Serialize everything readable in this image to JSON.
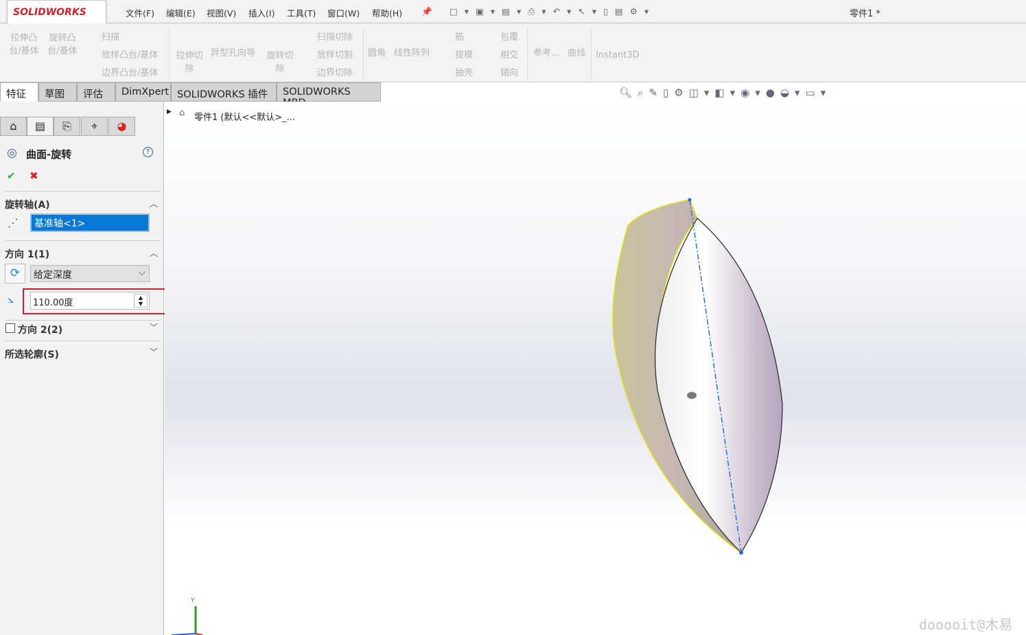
{
  "app": {
    "logo": "SOLIDWORKS",
    "title": "零件1 *"
  },
  "menu": [
    "文件(F)",
    "编辑(E)",
    "视图(V)",
    "插入(I)",
    "工具(T)",
    "窗口(W)",
    "帮助(H)"
  ],
  "ribbon": {
    "extrude_boss": "拉伸凸台/基体",
    "revolve_boss": "旋转凸台/基体",
    "sweep": "扫描",
    "loft": "放样凸台/基体",
    "boundary": "边界凸台/基体",
    "extrude_cut": "拉伸切除",
    "hole_wizard": "异型孔向导",
    "revolve_cut": "旋转切除",
    "sweep_cut": "扫描切除",
    "loft_cut": "放样切割",
    "boundary_cut": "边界切除",
    "fillet": "圆角",
    "linear_pattern": "线性阵列",
    "rib": "筋",
    "draft": "拔模",
    "shell": "抽壳",
    "wrap": "包覆",
    "intersect": "相交",
    "mirror": "镜向",
    "reference": "参考...",
    "curves": "曲线",
    "instant3d": "Instant3D"
  },
  "tabs": [
    "特征",
    "草图",
    "评估",
    "DimXpert",
    "SOLIDWORKS 插件",
    "SOLIDWORKS MBD"
  ],
  "tree": {
    "root": "零件1 (默认<<默认>_..."
  },
  "property_manager": {
    "title": "曲面-旋转",
    "axis_section": "旋转轴(A)",
    "axis_value": "基准轴<1>",
    "dir1_section": "方向 1(1)",
    "end_condition": "给定深度",
    "angle": "110.00度",
    "dir2_section": "方向 2(2)",
    "dir2_checked": false,
    "contours_section": "所选轮廓(S)"
  },
  "triad": {
    "y": "Y"
  },
  "watermark": "dooooit@木易"
}
